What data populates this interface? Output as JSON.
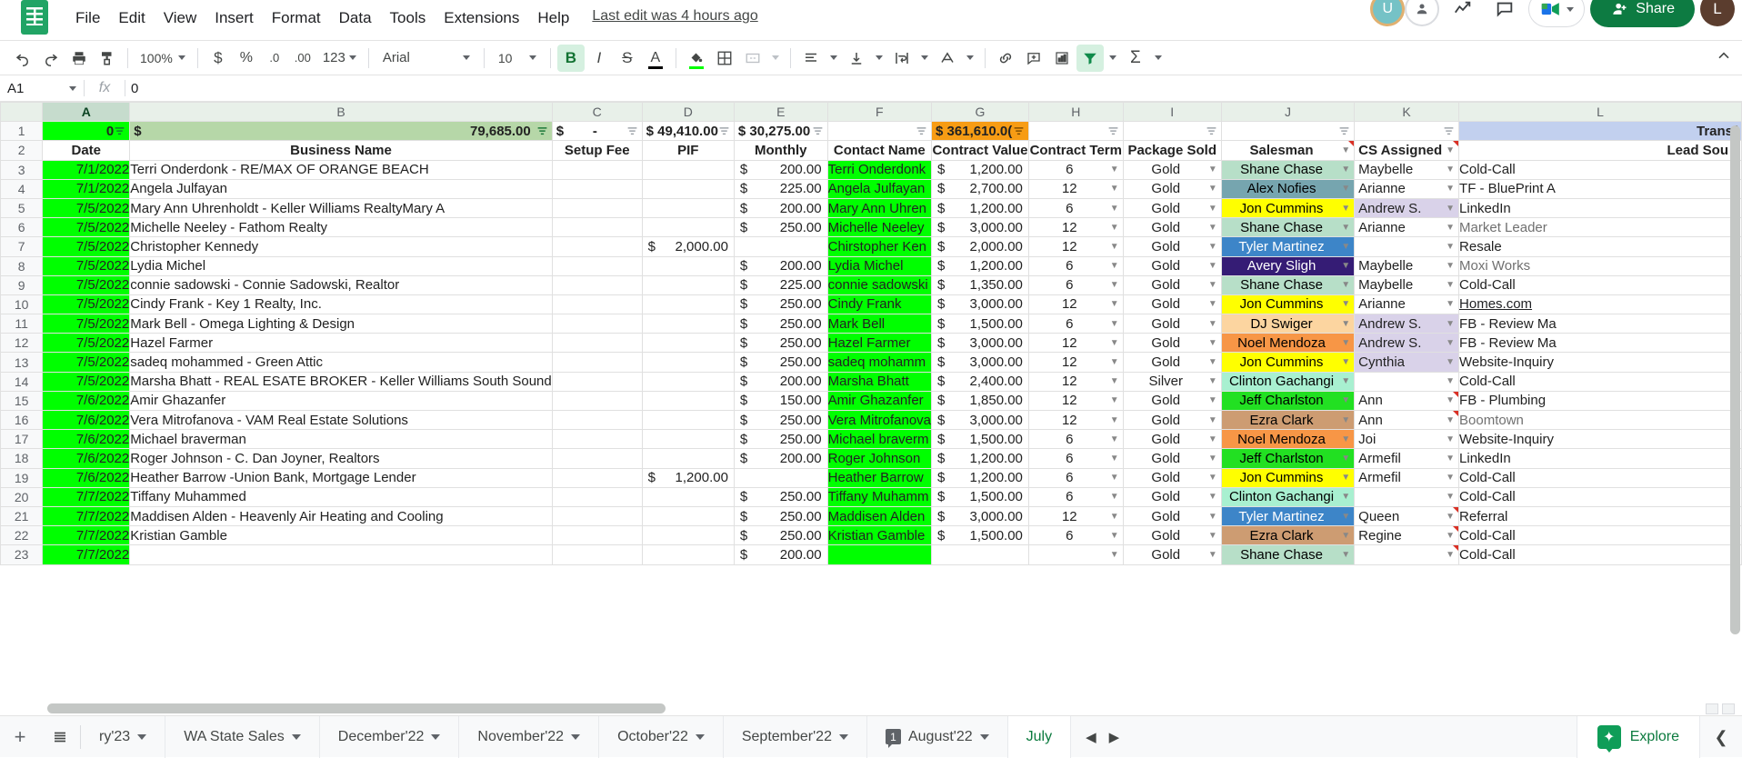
{
  "app": {
    "menus": [
      "File",
      "Edit",
      "View",
      "Insert",
      "Format",
      "Data",
      "Tools",
      "Extensions",
      "Help"
    ],
    "last_edit": "Last edit was 4 hours ago",
    "share_label": "Share",
    "user_initial": "L",
    "avatar_initial": "U"
  },
  "toolbar": {
    "zoom": "100%",
    "number_format": "123",
    "font": "Arial",
    "font_size": "10",
    "bold": "B",
    "italic": "I",
    "strikethrough": "S",
    "text_color": "A",
    "currency": "$",
    "percent": "%",
    "decimal_dec": ".0",
    "decimal_inc": ".00",
    "fill_color_hex": "#00ff00",
    "text_color_hex": "#000000",
    "accent_hex": "#137333"
  },
  "formula_bar": {
    "name_box": "A1",
    "fx_label": "fx",
    "value": "0"
  },
  "grid": {
    "column_letters": [
      "A",
      "B",
      "C",
      "D",
      "E",
      "F",
      "G",
      "H",
      "I",
      "J",
      "K",
      "L"
    ],
    "selected_column": "A",
    "row_numbers": [
      "1",
      "2",
      "3",
      "4",
      "5",
      "6",
      "7",
      "8",
      "9",
      "10",
      "11",
      "12",
      "13",
      "14",
      "15",
      "16",
      "17",
      "18",
      "19",
      "20",
      "21",
      "22",
      "23"
    ],
    "totals_row": {
      "a": "0",
      "b_symbol": "$",
      "b_value": "79,685.00",
      "c_symbol": "$",
      "c_value": "-",
      "d": "$ 49,410.00",
      "e": "$ 30,275.00",
      "f": "",
      "g": "$ 361,610.0(",
      "h": "",
      "i": "",
      "j": "",
      "k": "",
      "l": "Transf"
    },
    "headers": {
      "a": "Date",
      "b": "Business Name",
      "c": "Setup Fee",
      "d": "PIF",
      "e": "Monthly",
      "f": "Contact Name",
      "g": "Contract Value",
      "h": "Contract Term",
      "i": "Package Sold",
      "j": "Salesman",
      "k": "CS Assigned",
      "l": "Lead Sou"
    },
    "rows": [
      {
        "n": "3",
        "date": "7/1/2022",
        "business": "Terri Onderdonk - RE/MAX OF ORANGE BEACH",
        "setup": "",
        "pif": "",
        "monthly": "200.00",
        "contact": "Terri Onderdonk",
        "value": "1,200.00",
        "term": "6",
        "package": "Gold",
        "salesman": "Shane Chase",
        "salesman_bg": "#b7dfc8",
        "salesman_fg": "#000000",
        "cs": "Maybelle",
        "cs_bg": "#ffffff",
        "lead": "Cold-Call",
        "lead_style": "plain",
        "note": false
      },
      {
        "n": "4",
        "date": "7/1/2022",
        "business": " Angela Julfayan",
        "setup": "",
        "pif": "",
        "monthly": "225.00",
        "contact": " Angela Julfayan",
        "value": "2,700.00",
        "term": "12",
        "package": "Gold",
        "salesman": "Alex Nofies",
        "salesman_bg": "#76a5af",
        "salesman_fg": "#000000",
        "cs": "Arianne",
        "cs_bg": "#ffffff",
        "lead": "TF - BluePrint A",
        "lead_style": "plain",
        "note": false
      },
      {
        "n": "5",
        "date": "7/5/2022",
        "business": "Mary Ann Uhrenholdt - Keller Williams RealtyMary A",
        "setup": "",
        "pif": "",
        "monthly": "200.00",
        "contact": "Mary Ann Uhren",
        "value": "1,200.00",
        "term": "6",
        "package": "Gold",
        "salesman": "Jon Cummins",
        "salesman_bg": "#ffff00",
        "salesman_fg": "#000000",
        "cs": "Andrew S.",
        "cs_bg": "#d9d2e9",
        "lead": "LinkedIn",
        "lead_style": "plain",
        "note": false
      },
      {
        "n": "6",
        "date": "7/5/2022",
        "business": "Michelle Neeley - Fathom Realty",
        "setup": "",
        "pif": "",
        "monthly": "250.00",
        "contact": "Michelle Neeley",
        "value": "3,000.00",
        "term": "12",
        "package": "Gold",
        "salesman": "Shane Chase",
        "salesman_bg": "#b7dfc8",
        "salesman_fg": "#000000",
        "cs": "Arianne",
        "cs_bg": "#ffffff",
        "lead": "Market Leader",
        "lead_style": "gray",
        "note": false
      },
      {
        "n": "7",
        "date": "7/5/2022",
        "business": "Christopher Kennedy",
        "setup": "",
        "pif": "2,000.00",
        "monthly": "",
        "contact": "Chirstopher Ken",
        "value": "2,000.00",
        "term": "12",
        "package": "Gold",
        "salesman": "Tyler Martinez",
        "salesman_bg": "#3d85c8",
        "salesman_fg": "#ffffff",
        "cs": "",
        "cs_bg": "#ffffff",
        "lead": "Resale",
        "lead_style": "plain",
        "note": false
      },
      {
        "n": "8",
        "date": "7/5/2022",
        "business": "Lydia Michel",
        "setup": "",
        "pif": "",
        "monthly": "200.00",
        "contact": "Lydia Michel",
        "value": "1,200.00",
        "term": "6",
        "package": "Gold",
        "salesman": "Avery Sligh",
        "salesman_bg": "#351c75",
        "salesman_fg": "#ffffff",
        "cs": "Maybelle",
        "cs_bg": "#ffffff",
        "lead": "Moxi Works",
        "lead_style": "gray",
        "note": false
      },
      {
        "n": "9",
        "date": "7/5/2022",
        "business": "connie sadowski - Connie Sadowski, Realtor",
        "setup": "",
        "pif": "",
        "monthly": "225.00",
        "contact": "connie sadowski",
        "value": "1,350.00",
        "term": "6",
        "package": "Gold",
        "salesman": "Shane Chase",
        "salesman_bg": "#b7dfc8",
        "salesman_fg": "#000000",
        "cs": "Maybelle",
        "cs_bg": "#ffffff",
        "lead": "Cold-Call",
        "lead_style": "plain",
        "note": false
      },
      {
        "n": "10",
        "date": "7/5/2022",
        "business": "Cindy Frank - Key 1 Realty, Inc.",
        "setup": "",
        "pif": "",
        "monthly": "250.00",
        "contact": "Cindy Frank",
        "value": "3,000.00",
        "term": "12",
        "package": "Gold",
        "salesman": "Jon Cummins",
        "salesman_bg": "#ffff00",
        "salesman_fg": "#000000",
        "cs": "Arianne",
        "cs_bg": "#ffffff",
        "lead": "Homes.com",
        "lead_style": "link",
        "note": false
      },
      {
        "n": "11",
        "date": "7/5/2022",
        "business": "Mark Bell - Omega Lighting & Design",
        "setup": "",
        "pif": "",
        "monthly": "250.00",
        "contact": "Mark Bell",
        "value": "1,500.00",
        "term": "6",
        "package": "Gold",
        "salesman": "DJ Swiger",
        "salesman_bg": "#fcd5a0",
        "salesman_fg": "#000000",
        "cs": "Andrew S.",
        "cs_bg": "#d9d2e9",
        "lead": "FB - Review Ma",
        "lead_style": "plain",
        "note": false
      },
      {
        "n": "12",
        "date": "7/5/2022",
        "business": "Hazel Farmer",
        "setup": "",
        "pif": "",
        "monthly": "250.00",
        "contact": "Hazel Farmer",
        "value": "3,000.00",
        "term": "12",
        "package": "Gold",
        "salesman": "Noel Mendoza",
        "salesman_bg": "#f79646",
        "salesman_fg": "#000000",
        "cs": "Andrew S.",
        "cs_bg": "#d9d2e9",
        "lead": "FB - Review Ma",
        "lead_style": "plain",
        "note": false
      },
      {
        "n": "13",
        "date": "7/5/2022",
        "business": "sadeq mohammed - Green Attic",
        "setup": "",
        "pif": "",
        "monthly": "250.00",
        "contact": "sadeq mohamm",
        "value": "3,000.00",
        "term": "12",
        "package": "Gold",
        "salesman": "Jon Cummins",
        "salesman_bg": "#ffff00",
        "salesman_fg": "#000000",
        "cs": "Cynthia",
        "cs_bg": "#d9d2e9",
        "lead": "Website-Inquiry",
        "lead_style": "plain",
        "note": false
      },
      {
        "n": "14",
        "date": "7/5/2022",
        "business": "Marsha Bhatt - REAL ESATE BROKER - Keller Williams South Sound",
        "setup": "",
        "pif": "",
        "monthly": "200.00",
        "contact": "Marsha Bhatt",
        "value": "2,400.00",
        "term": "12",
        "package": "Silver",
        "salesman": "Clinton Gachangi",
        "salesman_bg": "#a8f0d0",
        "salesman_fg": "#000000",
        "cs": "",
        "cs_bg": "#ffffff",
        "lead": "Cold-Call",
        "lead_style": "plain",
        "note": false
      },
      {
        "n": "15",
        "date": "7/6/2022",
        "business": "Amir Ghazanfer",
        "setup": "",
        "pif": "",
        "monthly": "150.00",
        "contact": "Amir Ghazanfer",
        "value": "1,850.00",
        "term": "12",
        "package": "Gold",
        "salesman": "Jeff Charlston",
        "salesman_bg": "#22e022",
        "salesman_fg": "#000000",
        "cs": "Ann",
        "cs_bg": "#ffffff",
        "lead": "FB - Plumbing",
        "lead_style": "plain",
        "note": true
      },
      {
        "n": "16",
        "date": "7/6/2022",
        "business": "Vera Mitrofanova - VAM Real Estate Solutions",
        "setup": "",
        "pif": "",
        "monthly": "250.00",
        "contact": "Vera Mitrofanova",
        "value": "3,000.00",
        "term": "12",
        "package": "Gold",
        "salesman": "Ezra Clark",
        "salesman_bg": "#cd9c72",
        "salesman_fg": "#000000",
        "cs": "Ann",
        "cs_bg": "#ffffff",
        "lead": "Boomtown",
        "lead_style": "gray",
        "note": true
      },
      {
        "n": "17",
        "date": "7/6/2022",
        "business": "Michael braverman",
        "setup": "",
        "pif": "",
        "monthly": "250.00",
        "contact": "Michael braverm",
        "value": "1,500.00",
        "term": "6",
        "package": "Gold",
        "salesman": "Noel Mendoza",
        "salesman_bg": "#f79646",
        "salesman_fg": "#000000",
        "cs": "Joi",
        "cs_bg": "#ffffff",
        "lead": "Website-Inquiry",
        "lead_style": "plain",
        "note": false
      },
      {
        "n": "18",
        "date": "7/6/2022",
        "business": "Roger Johnson - C. Dan Joyner, Realtors",
        "setup": "",
        "pif": "",
        "monthly": "200.00",
        "contact": "Roger Johnson",
        "value": "1,200.00",
        "term": "6",
        "package": "Gold",
        "salesman": "Jeff Charlston",
        "salesman_bg": "#22e022",
        "salesman_fg": "#000000",
        "cs": "Armefil",
        "cs_bg": "#ffffff",
        "lead": "LinkedIn",
        "lead_style": "plain",
        "note": false
      },
      {
        "n": "19",
        "date": "7/6/2022",
        "business": "Heather Barrow -Union Bank, Mortgage Lender",
        "setup": "",
        "pif": "1,200.00",
        "monthly": "",
        "contact": "Heather Barrow",
        "value": "1,200.00",
        "term": "6",
        "package": "Gold",
        "salesman": "Jon Cummins",
        "salesman_bg": "#ffff00",
        "salesman_fg": "#000000",
        "cs": "Armefil",
        "cs_bg": "#ffffff",
        "lead": "Cold-Call",
        "lead_style": "plain",
        "note": false
      },
      {
        "n": "20",
        "date": "7/7/2022",
        "business": "Tiffany Muhammed",
        "setup": "",
        "pif": "",
        "monthly": "250.00",
        "contact": "Tiffany Muhamm",
        "value": "1,500.00",
        "term": "6",
        "package": "Gold",
        "salesman": "Clinton Gachangi",
        "salesman_bg": "#a8f0d0",
        "salesman_fg": "#000000",
        "cs": "",
        "cs_bg": "#ffffff",
        "lead": "Cold-Call",
        "lead_style": "plain",
        "note": false
      },
      {
        "n": "21",
        "date": "7/7/2022",
        "business": "Maddisen Alden - Heavenly Air Heating and Cooling",
        "setup": "",
        "pif": "",
        "monthly": "250.00",
        "contact": "Maddisen Alden",
        "value": "3,000.00",
        "term": "12",
        "package": "Gold",
        "salesman": "Tyler Martinez",
        "salesman_bg": "#3d85c8",
        "salesman_fg": "#ffffff",
        "cs": "Queen",
        "cs_bg": "#ffffff",
        "lead": "Referral",
        "lead_style": "plain",
        "note": true
      },
      {
        "n": "22",
        "date": "7/7/2022",
        "business": "Kristian Gamble",
        "setup": "",
        "pif": "",
        "monthly": "250.00",
        "contact": "Kristian Gamble",
        "value": "1,500.00",
        "term": "6",
        "package": "Gold",
        "salesman": "Ezra Clark",
        "salesman_bg": "#cd9c72",
        "salesman_fg": "#000000",
        "cs": "Regine",
        "cs_bg": "#ffffff",
        "lead": "Cold-Call",
        "lead_style": "plain",
        "note": true
      },
      {
        "n": "23",
        "date": "7/7/2022",
        "business": "",
        "setup": "",
        "pif": "",
        "monthly": "200.00",
        "contact": "",
        "value": "",
        "term": "",
        "package": "Gold",
        "salesman": "Shane Chase",
        "salesman_bg": "#b7dfc8",
        "salesman_fg": "#000000",
        "cs": "",
        "cs_bg": "#ffffff",
        "lead": "Cold-Call",
        "lead_style": "plain",
        "note": true
      }
    ]
  },
  "sheet_tabs": {
    "add_label": "+",
    "tabs": [
      {
        "label": "ry'23",
        "active": false,
        "badge": ""
      },
      {
        "label": "WA State Sales",
        "active": false,
        "badge": ""
      },
      {
        "label": "December'22",
        "active": false,
        "badge": ""
      },
      {
        "label": "November'22",
        "active": false,
        "badge": ""
      },
      {
        "label": "October'22",
        "active": false,
        "badge": ""
      },
      {
        "label": "September'22",
        "active": false,
        "badge": ""
      },
      {
        "label": "August'22",
        "active": false,
        "badge": "1"
      },
      {
        "label": "July",
        "active": true,
        "badge": ""
      }
    ],
    "explore_label": "Explore"
  }
}
